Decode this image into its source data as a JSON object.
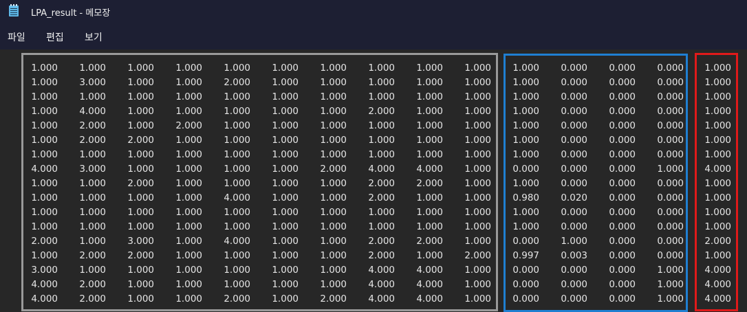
{
  "window": {
    "title": "LPA_result - 메모장"
  },
  "menu": [
    "파일",
    "편집",
    "보기"
  ],
  "icons": {
    "app": "notepad-icon"
  },
  "highlight_colors": {
    "input_columns": "#9a9a9a",
    "probability_columns": "#1f7fd1",
    "class_column": "#e01a1a"
  },
  "rows": [
    [
      "1.000",
      "1.000",
      "1.000",
      "1.000",
      "1.000",
      "1.000",
      "1.000",
      "1.000",
      "1.000",
      "1.000",
      "1.000",
      "0.000",
      "0.000",
      "0.000",
      "1.000"
    ],
    [
      "1.000",
      "3.000",
      "1.000",
      "1.000",
      "2.000",
      "1.000",
      "1.000",
      "1.000",
      "1.000",
      "1.000",
      "1.000",
      "0.000",
      "0.000",
      "0.000",
      "1.000"
    ],
    [
      "1.000",
      "1.000",
      "1.000",
      "1.000",
      "1.000",
      "1.000",
      "1.000",
      "1.000",
      "1.000",
      "1.000",
      "1.000",
      "0.000",
      "0.000",
      "0.000",
      "1.000"
    ],
    [
      "1.000",
      "4.000",
      "1.000",
      "1.000",
      "1.000",
      "1.000",
      "1.000",
      "2.000",
      "1.000",
      "1.000",
      "1.000",
      "0.000",
      "0.000",
      "0.000",
      "1.000"
    ],
    [
      "1.000",
      "2.000",
      "1.000",
      "2.000",
      "1.000",
      "1.000",
      "1.000",
      "1.000",
      "1.000",
      "1.000",
      "1.000",
      "0.000",
      "0.000",
      "0.000",
      "1.000"
    ],
    [
      "1.000",
      "2.000",
      "2.000",
      "1.000",
      "1.000",
      "1.000",
      "1.000",
      "1.000",
      "1.000",
      "1.000",
      "1.000",
      "0.000",
      "0.000",
      "0.000",
      "1.000"
    ],
    [
      "1.000",
      "1.000",
      "1.000",
      "1.000",
      "1.000",
      "1.000",
      "1.000",
      "1.000",
      "1.000",
      "1.000",
      "1.000",
      "0.000",
      "0.000",
      "0.000",
      "1.000"
    ],
    [
      "4.000",
      "3.000",
      "1.000",
      "1.000",
      "1.000",
      "1.000",
      "2.000",
      "4.000",
      "4.000",
      "1.000",
      "0.000",
      "0.000",
      "0.000",
      "1.000",
      "4.000"
    ],
    [
      "1.000",
      "1.000",
      "2.000",
      "1.000",
      "1.000",
      "1.000",
      "1.000",
      "2.000",
      "2.000",
      "1.000",
      "1.000",
      "0.000",
      "0.000",
      "0.000",
      "1.000"
    ],
    [
      "1.000",
      "1.000",
      "1.000",
      "1.000",
      "4.000",
      "1.000",
      "1.000",
      "2.000",
      "1.000",
      "1.000",
      "0.980",
      "0.020",
      "0.000",
      "0.000",
      "1.000"
    ],
    [
      "1.000",
      "1.000",
      "1.000",
      "1.000",
      "1.000",
      "1.000",
      "1.000",
      "1.000",
      "1.000",
      "1.000",
      "1.000",
      "0.000",
      "0.000",
      "0.000",
      "1.000"
    ],
    [
      "1.000",
      "1.000",
      "1.000",
      "1.000",
      "1.000",
      "1.000",
      "1.000",
      "1.000",
      "1.000",
      "1.000",
      "1.000",
      "0.000",
      "0.000",
      "0.000",
      "1.000"
    ],
    [
      "2.000",
      "1.000",
      "3.000",
      "1.000",
      "4.000",
      "1.000",
      "1.000",
      "2.000",
      "2.000",
      "1.000",
      "0.000",
      "1.000",
      "0.000",
      "0.000",
      "2.000"
    ],
    [
      "1.000",
      "2.000",
      "2.000",
      "1.000",
      "1.000",
      "1.000",
      "1.000",
      "2.000",
      "1.000",
      "2.000",
      "0.997",
      "0.003",
      "0.000",
      "0.000",
      "1.000"
    ],
    [
      "3.000",
      "1.000",
      "1.000",
      "1.000",
      "1.000",
      "1.000",
      "1.000",
      "4.000",
      "4.000",
      "1.000",
      "0.000",
      "0.000",
      "0.000",
      "1.000",
      "4.000"
    ],
    [
      "4.000",
      "2.000",
      "1.000",
      "1.000",
      "1.000",
      "1.000",
      "1.000",
      "4.000",
      "4.000",
      "1.000",
      "0.000",
      "0.000",
      "0.000",
      "1.000",
      "4.000"
    ],
    [
      "4.000",
      "2.000",
      "1.000",
      "1.000",
      "2.000",
      "1.000",
      "2.000",
      "4.000",
      "4.000",
      "1.000",
      "0.000",
      "0.000",
      "0.000",
      "1.000",
      "4.000"
    ]
  ]
}
